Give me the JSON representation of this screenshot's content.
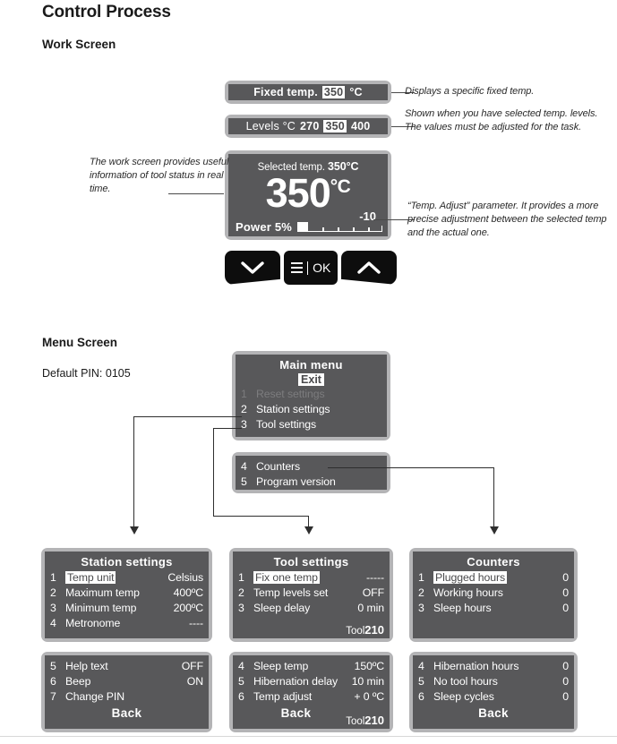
{
  "document": {
    "title": "Control Process",
    "sections": {
      "work_screen": "Work Screen",
      "menu_screen": "Menu Screen"
    },
    "default_pin": "Default PIN: 0105"
  },
  "colors": {
    "lcd_frame": "#b4b4b6",
    "lcd_screen": "#58585a",
    "lcd_text": "#ffffff",
    "lcd_dim_text": "#7c7c7e",
    "button_body": "#0d0d0d",
    "connector": "#2e2e2e"
  },
  "work_screen": {
    "fixed_temp": {
      "label": "Fixed temp.",
      "value": "350",
      "unit": "°C"
    },
    "levels": {
      "label": "Levels °C",
      "level_low": "270",
      "level_mid": "350",
      "level_high": "400"
    },
    "display": {
      "selected_label": "Selected temp.",
      "selected_value": "350",
      "selected_unit": "°C",
      "big_value": "350",
      "big_unit": "°C",
      "temp_adjust": "-10",
      "power_label": "Power 5%",
      "power_percent": 5
    },
    "buttons": {
      "down": "down-chevron",
      "menu": "menu-list",
      "ok": "OK",
      "up": "up-chevron"
    }
  },
  "notes": {
    "fixed_temp": "Displays a specific fixed temp.",
    "levels": "Shown when you have selected temp. levels. The values must be adjusted for the task.",
    "work_screen": "The work screen provides useful information of tool status in real time.",
    "temp_adjust": "“Temp. Adjust” parameter. It provides a more precise adjustment between the selected temp and the actual one."
  },
  "main_menu": {
    "title": "Main menu",
    "exit": "Exit",
    "items_top": [
      {
        "num": "1",
        "label": "Reset settings",
        "dimmed": true
      },
      {
        "num": "2",
        "label": "Station settings",
        "dimmed": false
      },
      {
        "num": "3",
        "label": "Tool settings",
        "dimmed": false
      }
    ],
    "items_bottom": [
      {
        "num": "4",
        "label": "Counters"
      },
      {
        "num": "5",
        "label": "Program version"
      }
    ]
  },
  "station_settings": {
    "title": "Station settings",
    "page1": [
      {
        "num": "1",
        "label": "Temp unit",
        "value": "Celsius",
        "highlighted": true
      },
      {
        "num": "2",
        "label": "Maximum temp",
        "value": "400ºC",
        "highlighted": false
      },
      {
        "num": "3",
        "label": "Minimum temp",
        "value": "200ºC",
        "highlighted": false
      },
      {
        "num": "4",
        "label": "Metronome",
        "value": "----",
        "highlighted": false
      }
    ],
    "page2": [
      {
        "num": "5",
        "label": "Help text",
        "value": "OFF"
      },
      {
        "num": "6",
        "label": "Beep",
        "value": "ON"
      },
      {
        "num": "7",
        "label": "Change PIN",
        "value": ""
      }
    ],
    "back": "Back"
  },
  "tool_settings": {
    "title": "Tool settings",
    "page1": [
      {
        "num": "1",
        "label": "Fix one temp",
        "value": "-----",
        "highlighted": true
      },
      {
        "num": "2",
        "label": "Temp levels set",
        "value": "OFF",
        "highlighted": false
      },
      {
        "num": "3",
        "label": "Sleep delay",
        "value": "0  min",
        "highlighted": false
      }
    ],
    "page2": [
      {
        "num": "4",
        "label": "Sleep temp",
        "value": "150ºC"
      },
      {
        "num": "5",
        "label": "Hibernation delay",
        "value": "10  min"
      },
      {
        "num": "6",
        "label": "Temp adjust",
        "value": "+ 0  ºC"
      }
    ],
    "back": "Back",
    "tool_label": "Tool",
    "tool_number": "210"
  },
  "counters": {
    "title": "Counters",
    "page1": [
      {
        "num": "1",
        "label": "Plugged hours",
        "value": "0",
        "highlighted": true
      },
      {
        "num": "2",
        "label": "Working hours",
        "value": "0",
        "highlighted": false
      },
      {
        "num": "3",
        "label": "Sleep hours",
        "value": "0",
        "highlighted": false
      }
    ],
    "page2": [
      {
        "num": "4",
        "label": "Hibernation hours",
        "value": "0"
      },
      {
        "num": "5",
        "label": "No tool hours",
        "value": "0"
      },
      {
        "num": "6",
        "label": "Sleep cycles",
        "value": "0"
      }
    ],
    "back": "Back"
  }
}
